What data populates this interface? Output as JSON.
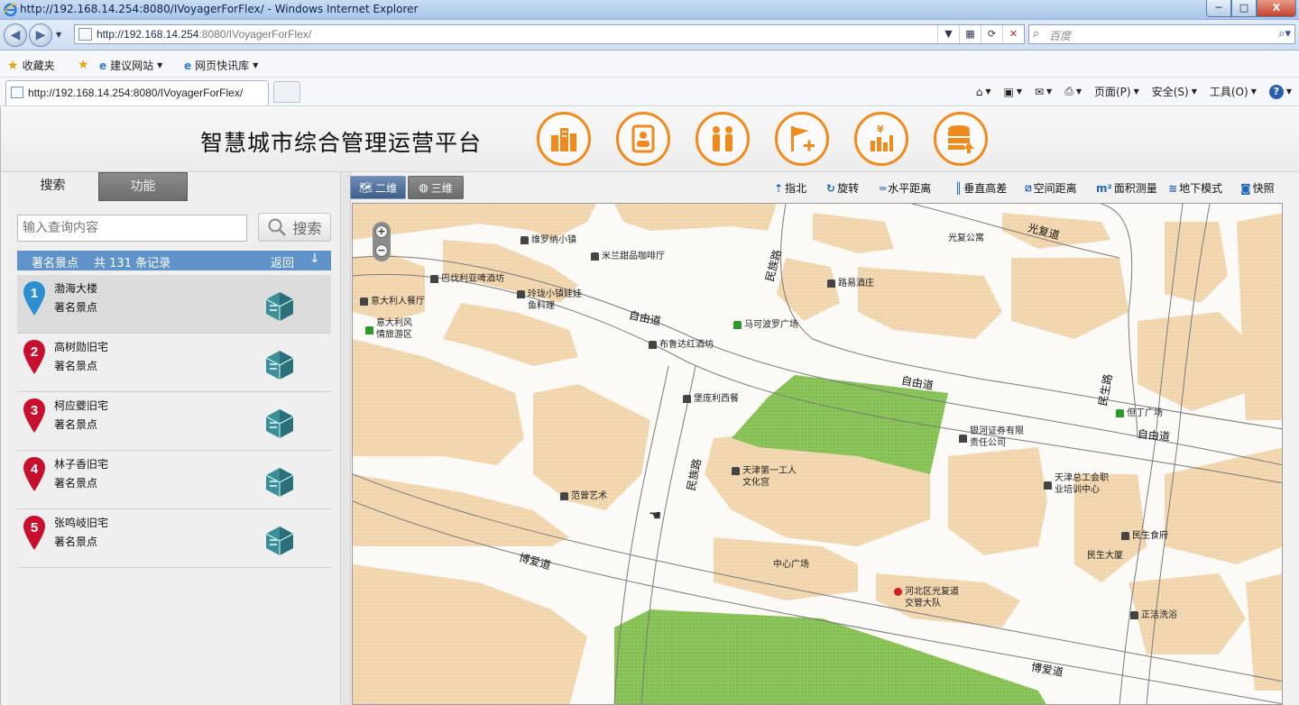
{
  "browser": {
    "window_title": "http://192.168.14.254:8080/IVoyagerForFlex/ - Windows Internet Explorer",
    "url_main": "http://192.168.14.254",
    "url_port_path": ":8080/IVoyagerForFlex/",
    "search_placeholder": "百度",
    "favorites": {
      "fav_label": "收藏夹",
      "item1": "建议网站",
      "item2": "网页快讯库"
    },
    "tab_title": "http://192.168.14.254:8080/IVoyagerForFlex/",
    "commands": {
      "page": "页面(P)",
      "safety": "安全(S)",
      "tools": "工具(O)"
    },
    "minimize": "─",
    "maximize": "□",
    "close": "X"
  },
  "app": {
    "title": "智慧城市综合管理运营平台",
    "modules": [
      "city-buildings",
      "id-card",
      "people",
      "flag-add",
      "finance-yen",
      "data-upload"
    ],
    "accent_color": "#f08a1c",
    "panel_tabs": {
      "search": "搜索",
      "function": "功能"
    },
    "query_placeholder": "输入查询内容",
    "search_button": "搜索",
    "result_header": {
      "category": "著名景点",
      "count_text": "共 131 条记录",
      "back": "返回",
      "arrow": "↓"
    },
    "results": [
      {
        "num": "1",
        "name": "渤海大楼",
        "type": "著名景点",
        "pin_color": "#2b8fd0"
      },
      {
        "num": "2",
        "name": "高树勋旧宅",
        "type": "著名景点",
        "pin_color": "#c8102e"
      },
      {
        "num": "3",
        "name": "柯应夔旧宅",
        "type": "著名景点",
        "pin_color": "#c8102e"
      },
      {
        "num": "4",
        "name": "林子香旧宅",
        "type": "著名景点",
        "pin_color": "#c8102e"
      },
      {
        "num": "5",
        "name": "张鸣岐旧宅",
        "type": "著名景点",
        "pin_color": "#c8102e"
      }
    ]
  },
  "map": {
    "view_2d": "二维",
    "view_3d": "三维",
    "tools": [
      "指北",
      "旋转",
      "水平距离",
      "垂直高差",
      "空间距离",
      "面积测量",
      "地下模式",
      "快照"
    ],
    "roads": [
      "光复道",
      "民族路",
      "自由道",
      "自由道",
      "民生路",
      "自由道",
      "民族路",
      "博爱道",
      "博爱道"
    ],
    "pois": {
      "p1": "维罗纳小镇",
      "p2": "米兰甜品咖啡厅",
      "p3": "巴伐利亚啤酒坊",
      "p4a": "玲珑小镇娃娃",
      "p4b": "鱼料理",
      "p5": "意大利人餐厅",
      "p6a": "意大利风",
      "p6b": "情旅游区",
      "p7": "路易酒庄",
      "p8": "光复公寓",
      "p9": "马可波罗广场",
      "p10": "布鲁达红酒坊",
      "p11": "堡庞利西餐",
      "p12": "但丁广场",
      "p13a": "银河证券有限",
      "p13b": "责任公司",
      "p14a": "天津第一工人",
      "p14b": "文化宫",
      "p15a": "天津总工会职",
      "p15b": "业培训中心",
      "p16": "范曾艺术",
      "p17": "民生食府",
      "p18": "民生大厦",
      "p19": "中心广场",
      "p20a": "河北区光复道",
      "p20b": "交管大队",
      "p21": "正洁洗浴"
    }
  }
}
